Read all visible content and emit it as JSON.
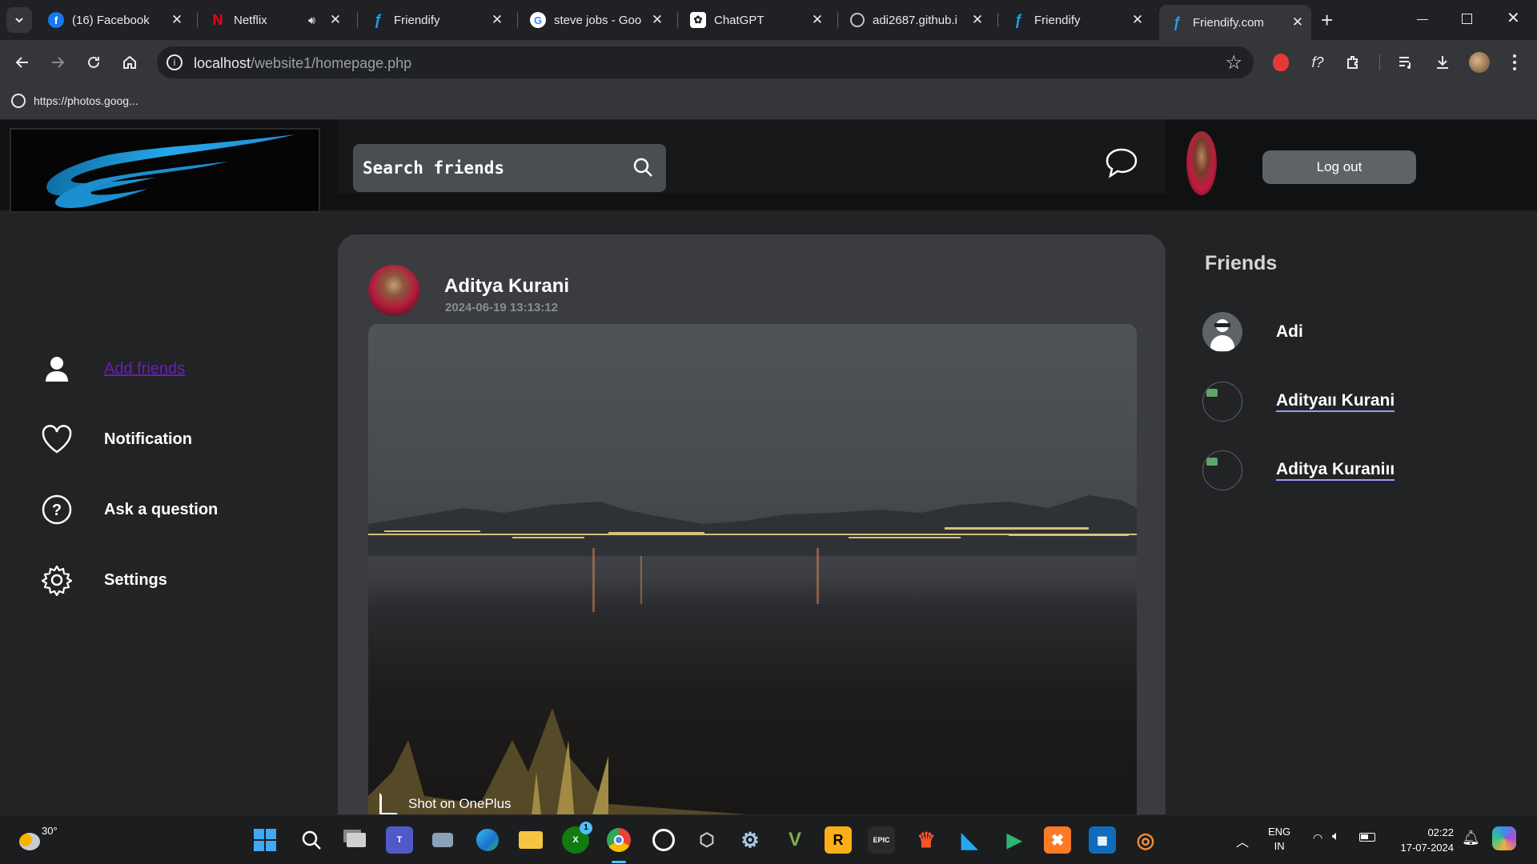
{
  "browser": {
    "tabs": [
      {
        "title": "(16) Facebook",
        "icon": "facebook-icon",
        "color": "#1877f2"
      },
      {
        "title": "Netflix",
        "icon": "netflix-icon",
        "color": "#e50914",
        "audio": true
      },
      {
        "title": "Friendify",
        "icon": "friendify-icon",
        "color": "#1da1f2"
      },
      {
        "title": "steve jobs - Goo",
        "icon": "google-icon",
        "color": "#4285f4"
      },
      {
        "title": "ChatGPT",
        "icon": "chatgpt-icon",
        "color": "#ffffff"
      },
      {
        "title": "adi2687.github.i",
        "icon": "globe-icon",
        "color": "#9aa0a6"
      },
      {
        "title": "Friendify",
        "icon": "friendify-icon",
        "color": "#1da1f2"
      },
      {
        "title": "Friendify.com",
        "icon": "friendify-icon",
        "color": "#1da1f2",
        "active": true
      }
    ],
    "url_host": "localhost",
    "url_path": "/website1/homepage.php",
    "bookmark": "https://photos.goog..."
  },
  "header": {
    "search_placeholder": "Search friends",
    "logout_label": "Log out"
  },
  "sidebar": {
    "items": [
      {
        "label": "Add friends",
        "icon": "person-icon",
        "link": true
      },
      {
        "label": "Notification",
        "icon": "heart-icon"
      },
      {
        "label": "Ask a question",
        "icon": "question-icon"
      },
      {
        "label": "Settings",
        "icon": "gear-icon"
      }
    ]
  },
  "post": {
    "author": "Aditya Kurani",
    "timestamp": "2024-06-19 13:13:12",
    "watermark": "Shot on OnePlus"
  },
  "friends": {
    "heading": "Friends",
    "list": [
      "Adi",
      "Adityaıı Kurani",
      "Aditya Kuraniıı"
    ]
  },
  "taskbar": {
    "weather": "30°",
    "lang_top": "ENG",
    "lang_bottom": "IN",
    "time": "02:22",
    "date": "17-07-2024",
    "xbox_badge": "1"
  },
  "colors": {
    "accent": "#1da1f2",
    "page_bg": "#212325",
    "card_bg": "#3a3c3f"
  }
}
